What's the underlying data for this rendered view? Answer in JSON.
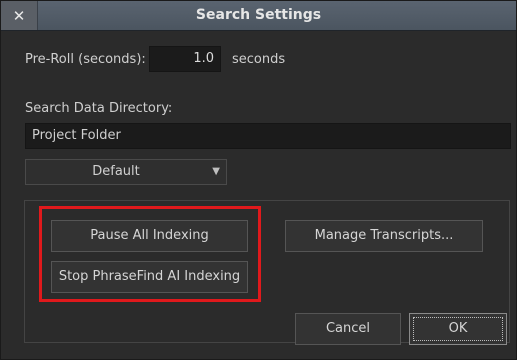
{
  "window": {
    "title": "Search Settings",
    "close_glyph": "✕"
  },
  "preroll": {
    "label": "Pre-Roll (seconds):",
    "value": "1.0",
    "unit": "seconds"
  },
  "search_dir": {
    "label": "Search Data Directory:",
    "value": "Project Folder"
  },
  "dropdown": {
    "selected": "Default",
    "arrow": "▼"
  },
  "buttons": {
    "pause_indexing": "Pause All Indexing",
    "stop_phrasefind": "Stop PhraseFind AI Indexing",
    "manage_transcripts": "Manage Transcripts...",
    "cancel": "Cancel",
    "ok": "OK"
  },
  "colors": {
    "highlight": "#e0191c",
    "titlebar": "#4b5560",
    "background": "#2b2b2b"
  }
}
